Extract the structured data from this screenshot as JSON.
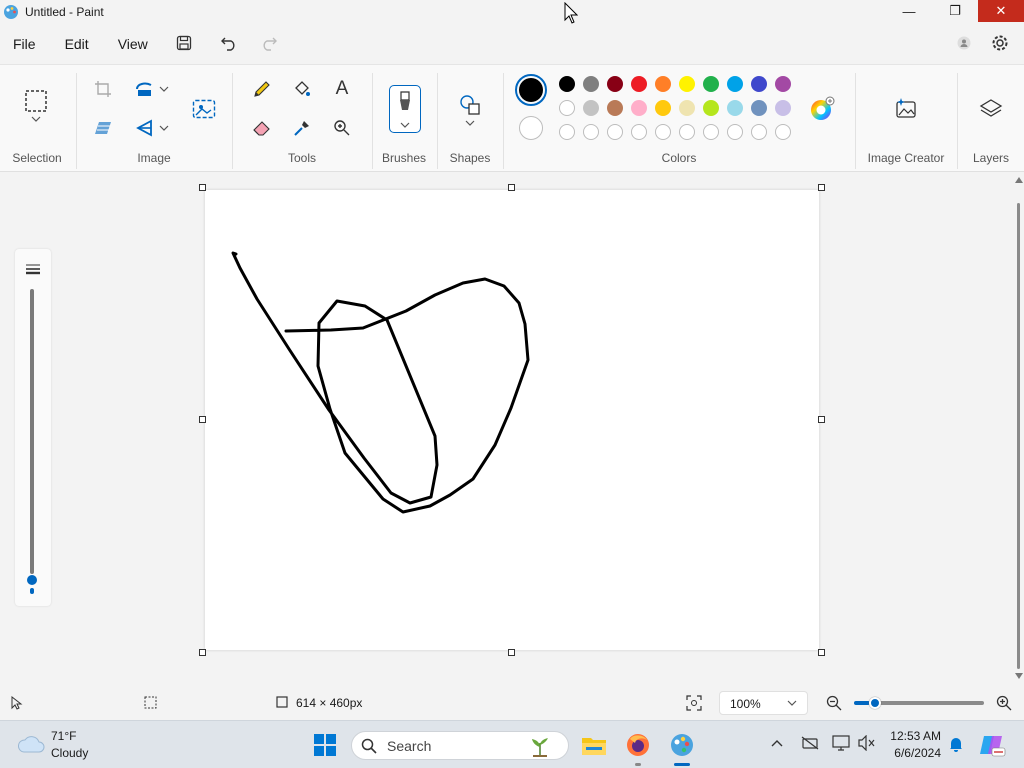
{
  "window": {
    "title": "Untitled - Paint",
    "minimize_glyph": "—",
    "restore_glyph": "❐",
    "close_glyph": "✕"
  },
  "menu": {
    "file": "File",
    "edit": "Edit",
    "view": "View"
  },
  "ribbon": {
    "groups": {
      "selection": "Selection",
      "image": "Image",
      "tools": "Tools",
      "brushes": "Brushes",
      "shapes": "Shapes",
      "colors": "Colors",
      "image_creator": "Image Creator",
      "layers": "Layers"
    },
    "tools": {
      "text_glyph": "A"
    },
    "colors": {
      "primary": "#000000",
      "secondary": "#ffffff",
      "row1": [
        "#000000",
        "#7f7f7f",
        "#880015",
        "#ed1c24",
        "#ff7f27",
        "#fff200",
        "#22b14c",
        "#00a2e8",
        "#3f48cc",
        "#a349a4"
      ],
      "row2": [
        "#ffffff",
        "#c3c3c3",
        "#b97a57",
        "#ffaec9",
        "#ffc90e",
        "#efe4b0",
        "#b5e61d",
        "#99d9ea",
        "#7092be",
        "#c8bfe7"
      ],
      "row3_empty_count": 10
    }
  },
  "status": {
    "canvas_size": "614 × 460px",
    "zoom": "100%"
  },
  "taskbar": {
    "weather_temp": "71°F",
    "weather_desc": "Cloudy",
    "search_label": "Search",
    "time": "12:53 AM",
    "date": "6/6/2024"
  },
  "accent": "#0067c0"
}
